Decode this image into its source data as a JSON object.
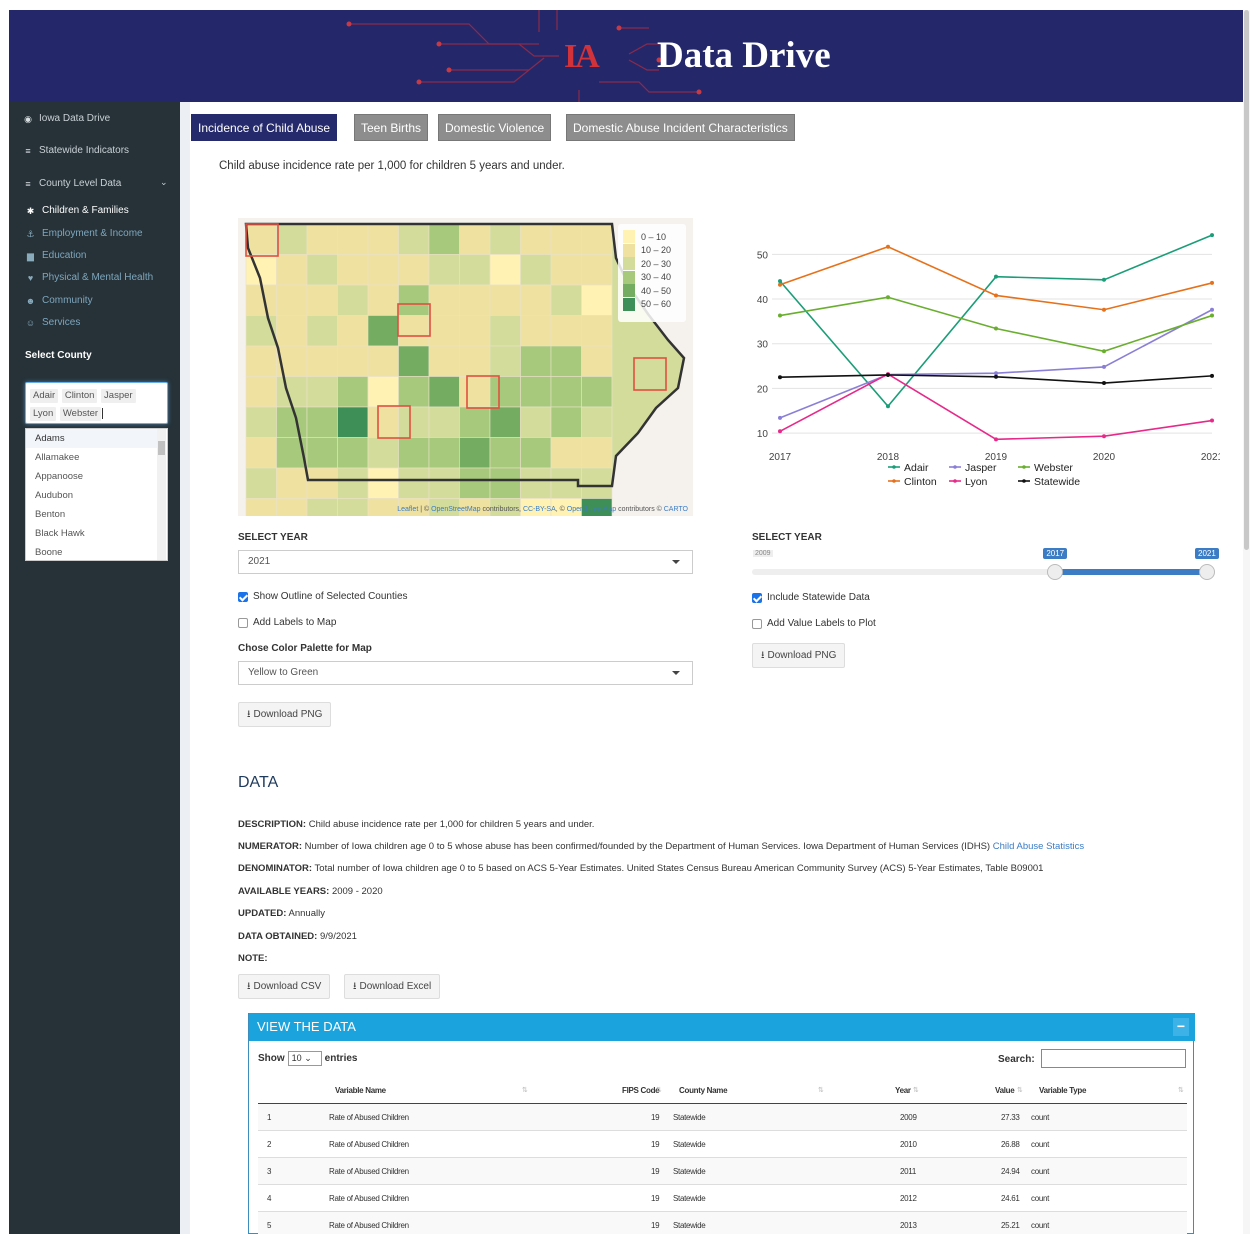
{
  "header": {
    "logo_initials": "IA",
    "logo_text": "Data Drive"
  },
  "sidebar": {
    "items": [
      {
        "label": "Iowa Data Drive",
        "icon": "dashboard-icon"
      },
      {
        "label": "Statewide Indicators",
        "icon": "database-icon"
      },
      {
        "label": "County Level Data",
        "icon": "database-icon"
      }
    ],
    "subitems": [
      {
        "label": "Children & Families",
        "icon": "child-icon"
      },
      {
        "label": "Employment & Income",
        "icon": "briefcase-icon"
      },
      {
        "label": "Education",
        "icon": "book-icon"
      },
      {
        "label": "Physical & Mental Health",
        "icon": "heart-icon"
      },
      {
        "label": "Community",
        "icon": "users-icon"
      },
      {
        "label": "Services",
        "icon": "user-gear-icon"
      }
    ],
    "select_county_label": "Select County",
    "selected_counties": [
      "Adair",
      "Clinton",
      "Jasper",
      "Lyon",
      "Webster"
    ],
    "county_options": [
      "Adams",
      "Allamakee",
      "Appanoose",
      "Audubon",
      "Benton",
      "Black Hawk",
      "Boone"
    ]
  },
  "tabs": [
    {
      "label": "Incidence of Child Abuse",
      "active": true
    },
    {
      "label": "Teen Births",
      "active": false
    },
    {
      "label": "Domestic Violence",
      "active": false
    },
    {
      "label": "Domestic Abuse Incident Characteristics",
      "active": false
    }
  ],
  "description": "Child abuse incidence rate per 1,000 for children 5 years and under.",
  "map": {
    "legend": [
      {
        "label": "0 – 10",
        "color": "#fff2b3"
      },
      {
        "label": "10 – 20",
        "color": "#efe1a0"
      },
      {
        "label": "20 – 30",
        "color": "#d3dc9a"
      },
      {
        "label": "30 – 40",
        "color": "#a7c97b"
      },
      {
        "label": "40 – 50",
        "color": "#74ad62"
      },
      {
        "label": "50 – 60",
        "color": "#3e8f57"
      }
    ],
    "attribution": {
      "leaflet": "Leaflet",
      "sep1": " | © ",
      "osm": "OpenStreetMap",
      "contrib": " contributors, ",
      "cc": "CC-BY-SA",
      "sep2": ", © ",
      "osm2": "OpenStreetMap",
      "contrib2": " contributors © ",
      "carto": "CARTO"
    }
  },
  "map_controls": {
    "select_year_label": "SELECT YEAR",
    "year_value": "2021",
    "show_outline_label": "Show Outline of Selected Counties",
    "show_outline_checked": true,
    "add_labels_label": "Add Labels to Map",
    "add_labels_checked": false,
    "palette_label": "Chose Color Palette for Map",
    "palette_value": "Yellow to Green",
    "download_label": "Download PNG"
  },
  "chart_controls": {
    "select_year_label": "SELECT YEAR",
    "slider_min": "2009",
    "slider_from": "2017",
    "slider_to": "2021",
    "slider_min_value": 2009,
    "slider_max_value": 2021,
    "include_statewide_label": "Include Statewide Data",
    "include_statewide_checked": true,
    "value_labels_label": "Add Value Labels to Plot",
    "value_labels_checked": false,
    "download_label": "Download PNG"
  },
  "chart_data": {
    "type": "line",
    "x": [
      2017,
      2018,
      2019,
      2020,
      2021
    ],
    "x_tick_labels": [
      "2017",
      "2018",
      "2019",
      "2020",
      "2021"
    ],
    "y_ticks": [
      10,
      20,
      30,
      40,
      50
    ],
    "y_tick_labels": [
      "10",
      "20",
      "30",
      "40",
      "50"
    ],
    "ylim": [
      8,
      55
    ],
    "grid": true,
    "legend_placement": "bottom",
    "series": [
      {
        "name": "Adair",
        "color": "#1b9e77",
        "values": [
          44,
          16,
          45,
          44.3,
          54.3
        ]
      },
      {
        "name": "Clinton",
        "color": "#e6711b",
        "values": [
          43.2,
          51.7,
          40.8,
          37.6,
          43.6
        ]
      },
      {
        "name": "Jasper",
        "color": "#8a7fd6",
        "values": [
          13.4,
          23.1,
          23.4,
          24.8,
          37.6
        ]
      },
      {
        "name": "Lyon",
        "color": "#e7298a",
        "values": [
          10.4,
          23.2,
          8.6,
          9.3,
          12.8
        ]
      },
      {
        "name": "Webster",
        "color": "#6aae2f",
        "values": [
          36.3,
          40.4,
          33.4,
          28.3,
          36.3
        ]
      },
      {
        "name": "Statewide",
        "color": "#111111",
        "values": [
          22.5,
          23,
          22.6,
          21.2,
          22.8
        ]
      }
    ]
  },
  "data_section": {
    "title": "DATA",
    "rows": [
      {
        "label": "DESCRIPTION:",
        "text": " Child abuse incidence rate per 1,000 for children 5 years and under."
      },
      {
        "label": "NUMERATOR:",
        "text": " Number of Iowa children age 0 to 5 whose abuse has been confirmed/founded by the Department of Human Services. Iowa Department of Human Services (IDHS) ",
        "link": "Child Abuse Statistics"
      },
      {
        "label": "DENOMINATOR:",
        "text": " Total number of Iowa children age 0 to 5 based on ACS 5-Year Estimates. United States Census Bureau American Community Survey (ACS) 5-Year Estimates, Table B09001"
      },
      {
        "label": "AVAILABLE YEARS:",
        "text": " 2009 - 2020"
      },
      {
        "label": "UPDATED:",
        "text": " Annually"
      },
      {
        "label": "DATA OBTAINED:",
        "text": " 9/9/2021"
      },
      {
        "label": "NOTE:",
        "text": ""
      }
    ],
    "download_csv": "Download CSV",
    "download_excel": "Download Excel"
  },
  "table": {
    "title": "VIEW THE DATA",
    "minimize": "−",
    "show_label": "Show",
    "entries_label": "entries",
    "page_size": "10",
    "search_label": "Search:",
    "columns": [
      "Variable Name",
      "FIPS Code",
      "County Name",
      "Year",
      "Value",
      "Variable Type"
    ],
    "rows": [
      [
        "1",
        "Rate of Abused Children",
        "19",
        "Statewide",
        "2009",
        "27.33",
        "count"
      ],
      [
        "2",
        "Rate of Abused Children",
        "19",
        "Statewide",
        "2010",
        "26.88",
        "count"
      ],
      [
        "3",
        "Rate of Abused Children",
        "19",
        "Statewide",
        "2011",
        "24.94",
        "count"
      ],
      [
        "4",
        "Rate of Abused Children",
        "19",
        "Statewide",
        "2012",
        "24.61",
        "count"
      ],
      [
        "5",
        "Rate of Abused Children",
        "19",
        "Statewide",
        "2013",
        "25.21",
        "count"
      ]
    ]
  }
}
